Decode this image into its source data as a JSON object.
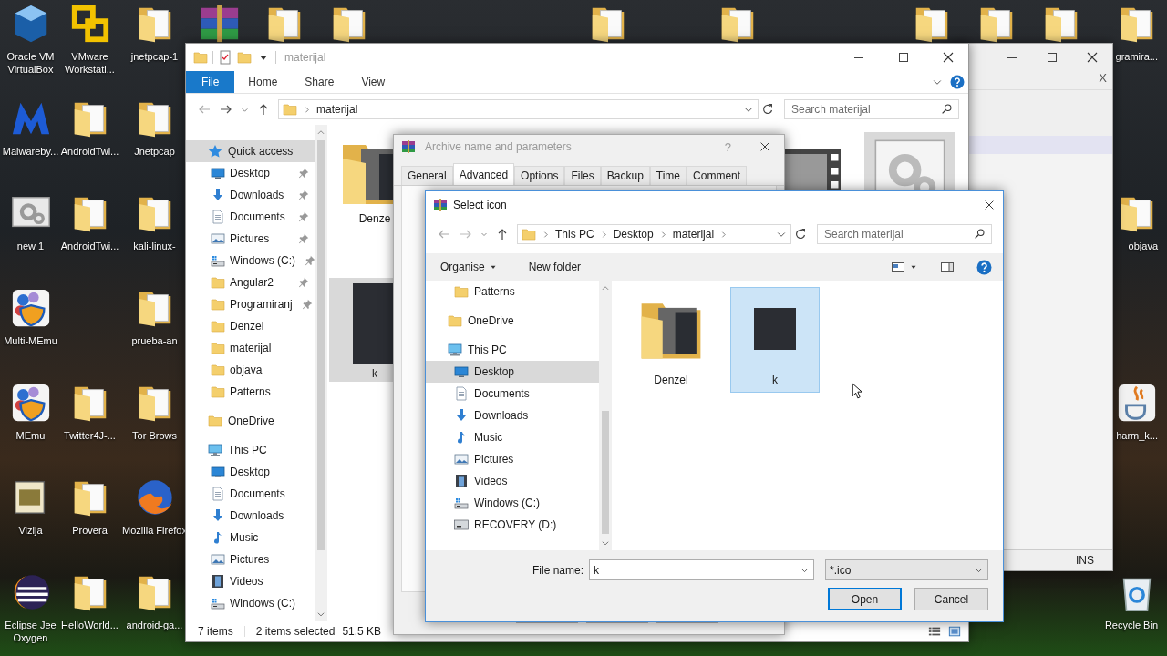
{
  "desktop": {
    "columns": [
      [
        {
          "label": "Oracle VM VirtualBox",
          "kind": "cube"
        },
        {
          "label": "Malwareby...",
          "kind": "mlogo"
        },
        {
          "label": "new 1",
          "kind": "settingswin"
        },
        {
          "label": "Multi-MEmu",
          "kind": "shield"
        },
        {
          "label": "MEmu",
          "kind": "shield"
        },
        {
          "label": "Vizija",
          "kind": "notebook"
        },
        {
          "label": "Eclipse Jee Oxygen",
          "kind": "eclipse"
        }
      ],
      [
        {
          "label": "VMware Workstati...",
          "kind": "vmware"
        },
        {
          "label": "AndroidTwi...",
          "kind": "bigfolder"
        },
        {
          "label": "AndroidTwi...",
          "kind": "bigfolder"
        },
        null,
        {
          "label": "Twitter4J-...",
          "kind": "bigfolder"
        },
        {
          "label": "Provera",
          "kind": "bigfolder"
        },
        {
          "label": "HelloWorld...",
          "kind": "bigfolder"
        }
      ],
      [
        {
          "label": "jnetpcap-1",
          "kind": "bigfolder"
        },
        {
          "label": "Jnetpcap",
          "kind": "bigfolder"
        },
        {
          "label": "kali-linux-",
          "kind": "bigfolder"
        },
        {
          "label": "prueba-an",
          "kind": "bigfolder"
        },
        {
          "label": "Tor Brows",
          "kind": "bigfolder"
        },
        {
          "label": "Mozilla Firefox",
          "kind": "fox"
        },
        {
          "label": "android-ga...",
          "kind": "bigfolder"
        }
      ],
      [
        {
          "kind": "books"
        }
      ],
      [
        {
          "kind": "bigfolder"
        }
      ],
      [
        {
          "kind": "bigfolder"
        }
      ],
      null,
      null,
      null,
      [
        {
          "kind": "bigfolder"
        }
      ],
      null,
      [
        {
          "kind": "bigfolder"
        }
      ],
      null,
      null,
      [
        {
          "kind": "bigfolder"
        }
      ],
      [
        {
          "kind": "bigfolder"
        }
      ],
      [
        {
          "kind": "bigfolder"
        }
      ],
      [
        {
          "label": "gramira...",
          "kind": "bigfolder"
        },
        null,
        {
          "label": "objava",
          "kind": "bigfolder"
        },
        null,
        {
          "label": "harm_k...",
          "kind": "java"
        },
        null,
        {
          "label": "Recycle Bin",
          "kind": "recycle"
        }
      ]
    ]
  },
  "back_window": {
    "close_glyph": "X",
    "status": "INS"
  },
  "explorer": {
    "title": "materijal",
    "ribbon_tabs": [
      {
        "label": "File",
        "selected": true
      },
      {
        "label": "Home",
        "selected": false
      },
      {
        "label": "Share",
        "selected": false
      },
      {
        "label": "View",
        "selected": false
      }
    ],
    "address": "materijal",
    "search_placeholder": "Search materijal",
    "nav": [
      {
        "label": "Quick access",
        "kind": "star",
        "selected": true,
        "children": [
          {
            "label": "Desktop",
            "kind": "desktop",
            "selected": false,
            "pinned": true
          },
          {
            "label": "Downloads",
            "kind": "download",
            "selected": false,
            "pinned": true
          },
          {
            "label": "Documents",
            "kind": "document",
            "selected": false,
            "pinned": true
          },
          {
            "label": "Pictures",
            "kind": "picture",
            "selected": false,
            "pinned": true
          },
          {
            "label": "Windows (C:)",
            "kind": "drive",
            "selected": false,
            "pinned": true
          },
          {
            "label": "Angular2",
            "kind": "folder",
            "selected": false,
            "pinned": true
          },
          {
            "label": "Programiranj",
            "kind": "folder",
            "selected": false,
            "pinned": true
          },
          {
            "label": "Denzel",
            "kind": "folder",
            "selected": false,
            "pinned": false
          },
          {
            "label": "materijal",
            "kind": "folder",
            "selected": false,
            "pinned": false
          },
          {
            "label": "objava",
            "kind": "folder",
            "selected": false,
            "pinned": false
          },
          {
            "label": "Patterns",
            "kind": "folder",
            "selected": false,
            "pinned": false
          }
        ]
      },
      {
        "label": "OneDrive",
        "kind": "folder",
        "selected": false
      },
      {
        "label": "This PC",
        "kind": "pc",
        "selected": false,
        "children": [
          {
            "label": "Desktop",
            "kind": "desktop",
            "selected": false,
            "pinned": false
          },
          {
            "label": "Documents",
            "kind": "document",
            "selected": false,
            "pinned": false
          },
          {
            "label": "Downloads",
            "kind": "download",
            "selected": false,
            "pinned": false
          },
          {
            "label": "Music",
            "kind": "music",
            "selected": false,
            "pinned": false
          },
          {
            "label": "Pictures",
            "kind": "picture",
            "selected": false,
            "pinned": false
          },
          {
            "label": "Videos",
            "kind": "videos",
            "selected": false,
            "pinned": false
          },
          {
            "label": "Windows (C:)",
            "kind": "drive",
            "selected": false,
            "pinned": false
          }
        ]
      }
    ],
    "items_left": [
      {
        "label": "Denze",
        "kind": "photofolder",
        "selected": false
      },
      {
        "label": "k",
        "kind": "photo",
        "selected": true
      }
    ],
    "items_right": [
      {
        "kind": "film",
        "selected": false
      },
      {
        "kind": "gearimg",
        "selected": true
      }
    ],
    "status": {
      "count": "7 items",
      "selection": "2 items selected",
      "size": "51,5 KB"
    }
  },
  "archive_dialog": {
    "title": "Archive name and parameters",
    "help_glyph": "?",
    "tabs": [
      {
        "label": "General",
        "selected": false
      },
      {
        "label": "Advanced",
        "selected": true
      },
      {
        "label": "Options",
        "selected": false
      },
      {
        "label": "Files",
        "selected": false
      },
      {
        "label": "Backup",
        "selected": false
      },
      {
        "label": "Time",
        "selected": false
      },
      {
        "label": "Comment",
        "selected": false
      }
    ]
  },
  "select_dialog": {
    "title": "Select icon",
    "breadcrumb": [
      "This PC",
      "Desktop",
      "materijal"
    ],
    "search_placeholder": "Search materijal",
    "toolbar": [
      {
        "label": "Organise",
        "kind": "menu"
      },
      {
        "label": "New folder",
        "kind": "button"
      }
    ],
    "nav": [
      {
        "children": [
          {
            "label": "Patterns",
            "kind": "folder",
            "selected": false
          }
        ]
      },
      {
        "label": "OneDrive",
        "kind": "folder",
        "selected": false
      },
      {
        "label": "This PC",
        "kind": "pc",
        "selected": false,
        "children": [
          {
            "label": "Desktop",
            "kind": "desktop",
            "selected": true
          },
          {
            "label": "Documents",
            "kind": "document",
            "selected": false
          },
          {
            "label": "Downloads",
            "kind": "download",
            "selected": false
          },
          {
            "label": "Music",
            "kind": "music",
            "selected": false
          },
          {
            "label": "Pictures",
            "kind": "picture",
            "selected": false
          },
          {
            "label": "Videos",
            "kind": "videos",
            "selected": false
          },
          {
            "label": "Windows (C:)",
            "kind": "drive",
            "selected": false
          },
          {
            "label": "RECOVERY (D:)",
            "kind": "recovery",
            "selected": false
          }
        ]
      }
    ],
    "items": [
      {
        "label": "Denzel",
        "kind": "photofolder",
        "selected": false
      },
      {
        "label": "k",
        "kind": "photo",
        "selected": true
      }
    ],
    "file_name_label": "File name:",
    "file_name": "k",
    "filter": "*.ico",
    "buttons": [
      {
        "label": "Open",
        "default": true
      },
      {
        "label": "Cancel",
        "default": false
      }
    ]
  }
}
